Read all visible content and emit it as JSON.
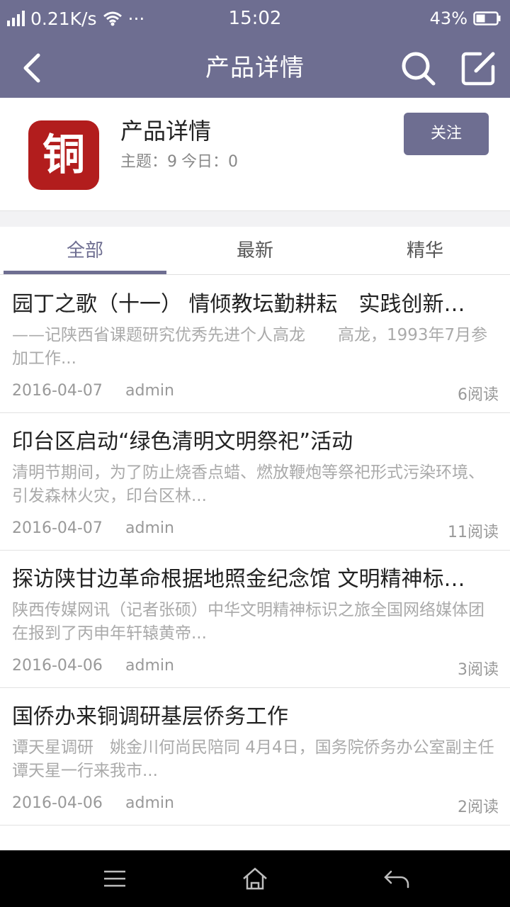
{
  "status_bar": {
    "network_speed": "0.21K/s",
    "more": "···",
    "time": "15:02",
    "battery": "43%",
    "icons": [
      "signal-icon",
      "wifi-icon",
      "battery-icon"
    ]
  },
  "nav": {
    "title": "产品详情",
    "icons": [
      "back-icon",
      "search-icon",
      "edit-icon"
    ],
    "accent_color": "#6e6e91"
  },
  "forum": {
    "logo_glyph": "铜",
    "logo_color": "#b21d1d",
    "name": "产品详情",
    "topics_label": "主题：9",
    "today_label": "今日：0",
    "follow_label": "关注"
  },
  "tabs": [
    {
      "label": "全部",
      "active": true
    },
    {
      "label": "最新",
      "active": false
    },
    {
      "label": "精华",
      "active": false
    }
  ],
  "posts": [
    {
      "title": "园丁之歌（十一） 情倾教坛勤耕耘　实践创新…",
      "summary": "——记陕西省课题研究优秀先进个人高龙　　高龙，1993年7月参加工作...",
      "date": "2016-04-07",
      "author": "admin",
      "views": "6阅读"
    },
    {
      "title": "印台区启动“绿色清明文明祭祀”活动",
      "summary": "清明节期间，为了防止烧香点蜡、燃放鞭炮等祭祀形式污染环境、引发森林火灾，印台区林...",
      "date": "2016-04-07",
      "author": "admin",
      "views": "11阅读"
    },
    {
      "title": "探访陕甘边革命根据地照金纪念馆 文明精神标…",
      "summary": "陕西传媒网讯（记者张硕）中华文明精神标识之旅全国网络媒体团在报到了丙申年轩辕黄帝...",
      "date": "2016-04-06",
      "author": "admin",
      "views": "3阅读"
    },
    {
      "title": "国侨办来铜调研基层侨务工作",
      "summary": "谭天星调研　姚金川何尚民陪同  4月4日，国务院侨务办公室副主任谭天星一行来我市...",
      "date": "2016-04-06",
      "author": "admin",
      "views": "2阅读"
    }
  ],
  "system_nav": {
    "icons": [
      "menu-icon",
      "home-icon",
      "back-arrow-icon"
    ]
  }
}
